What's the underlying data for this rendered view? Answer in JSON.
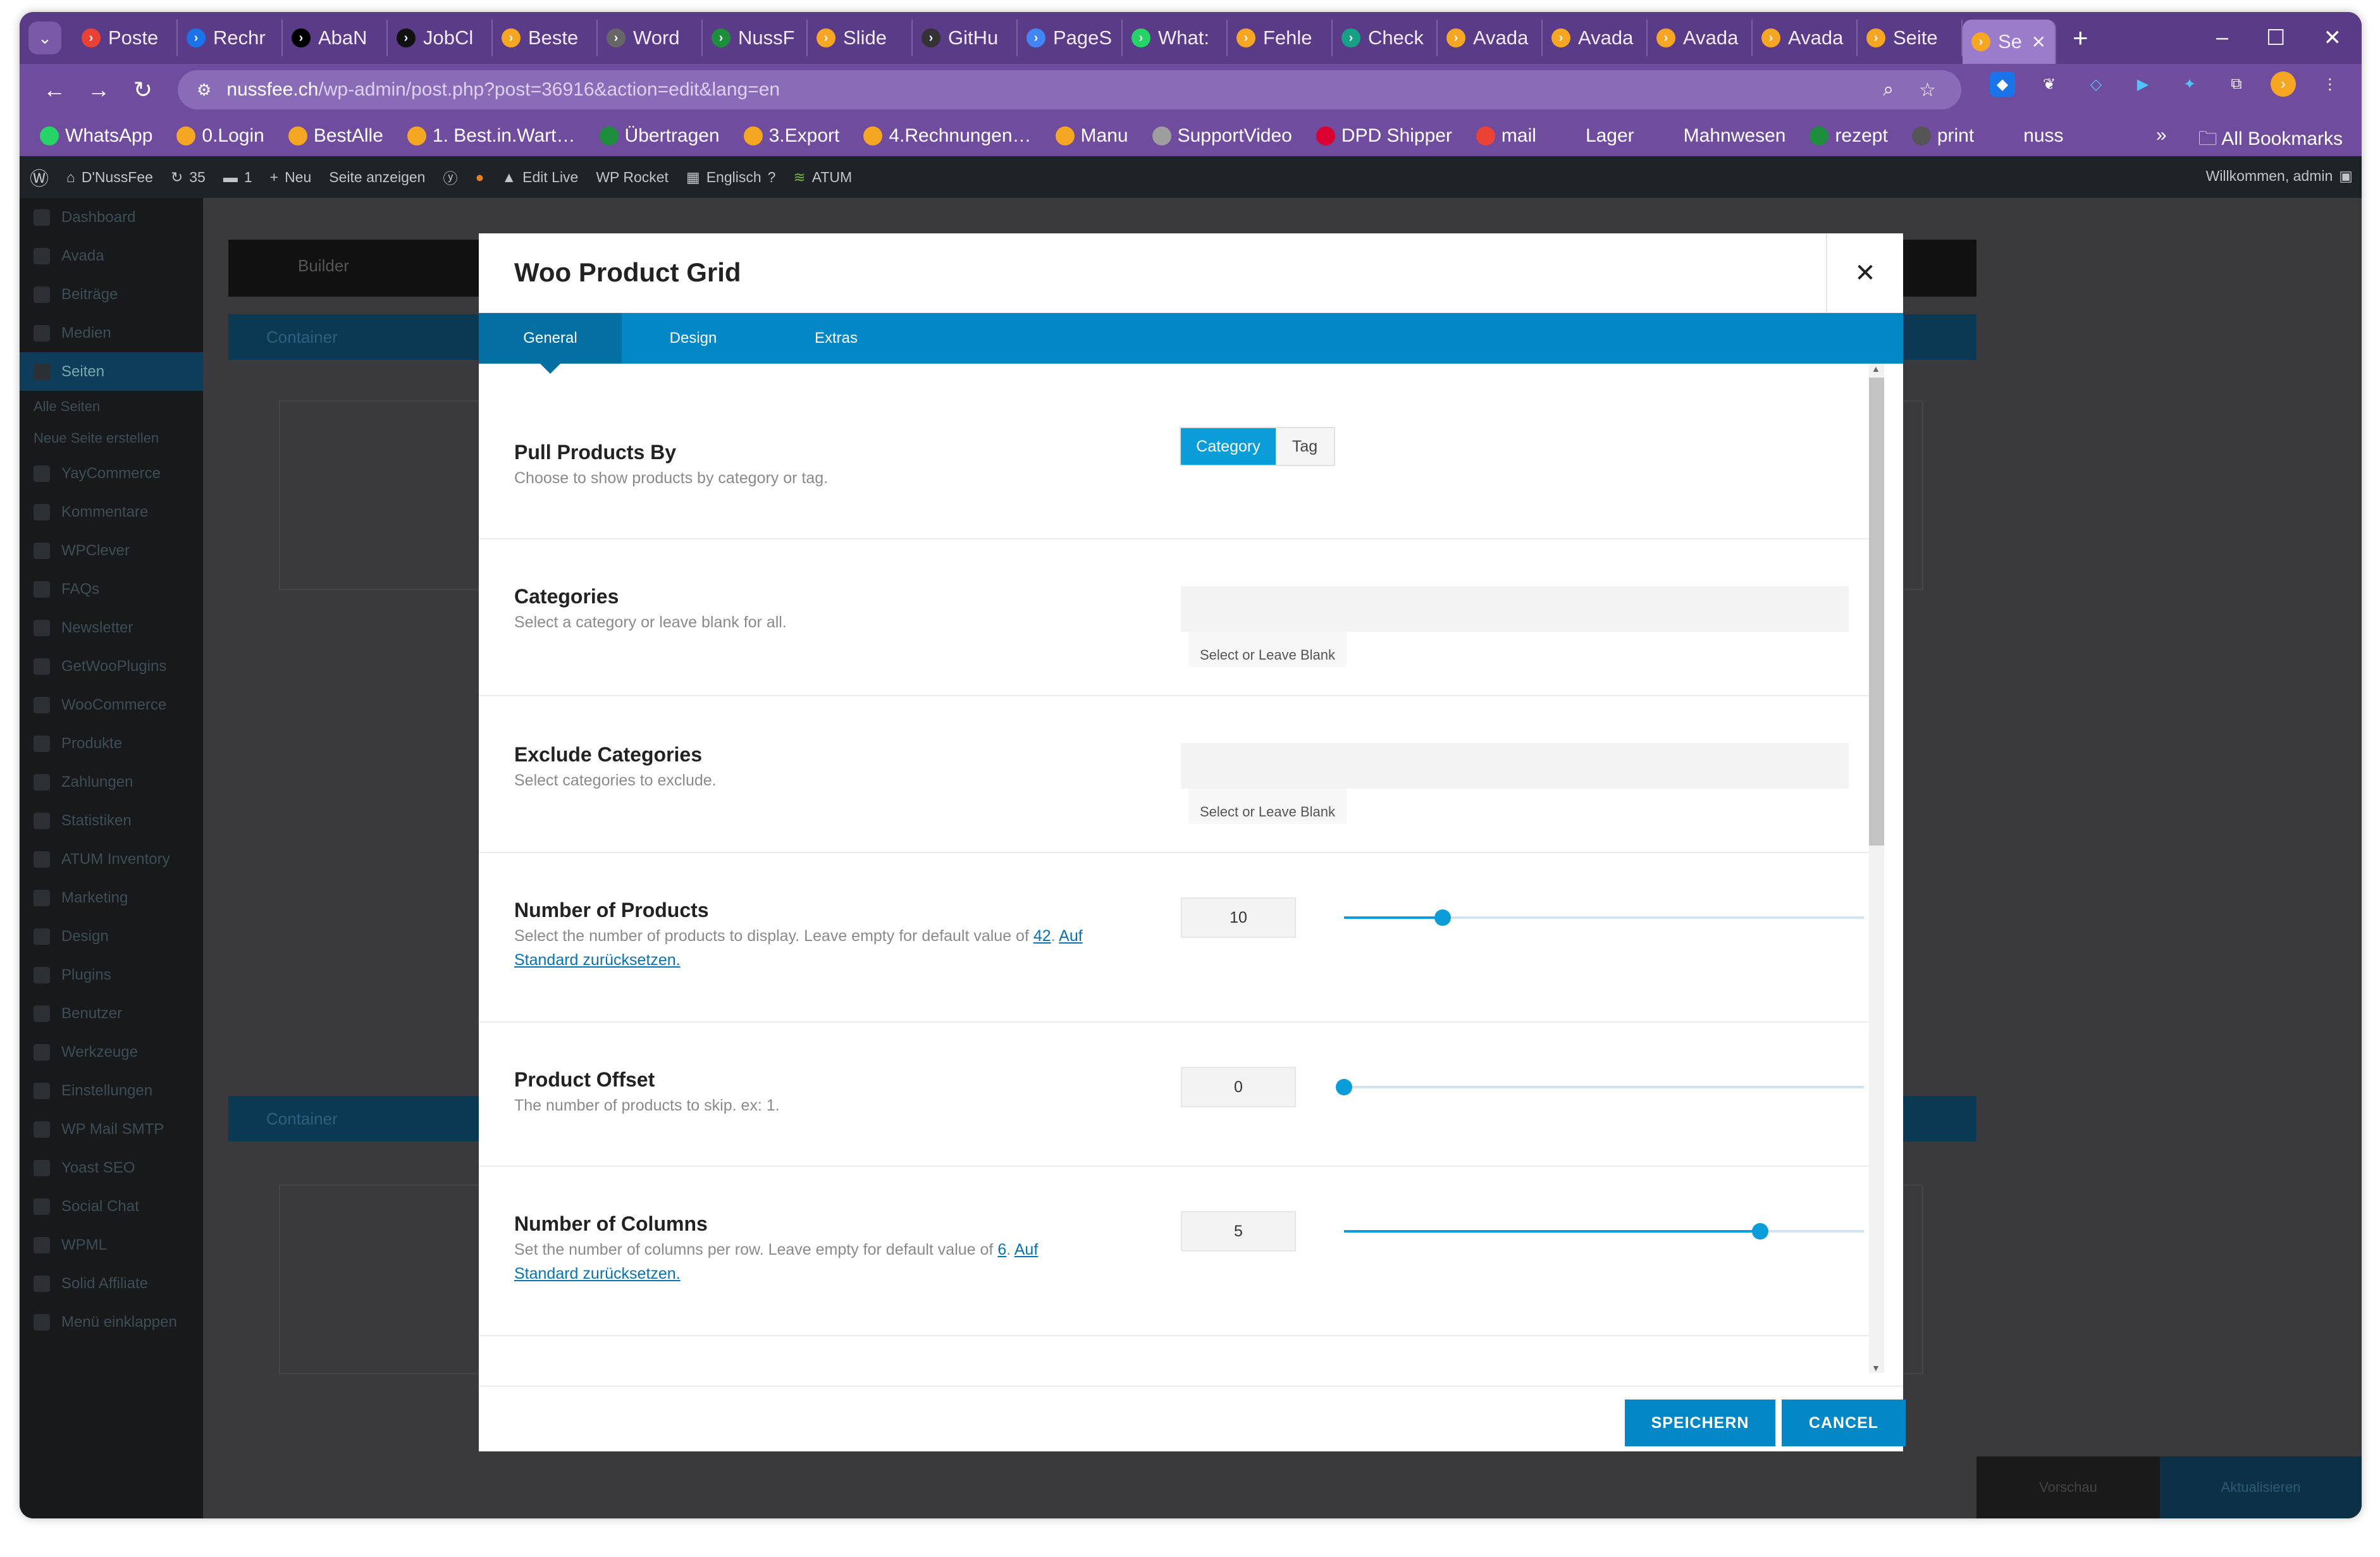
{
  "browser": {
    "tabs": [
      {
        "label": "Poste",
        "icon": "gmail-icon",
        "color": "#ea4335"
      },
      {
        "label": "Rechr",
        "icon": "play-arrow-icon",
        "color": "#1a73e8"
      },
      {
        "label": "AbaN",
        "icon": "notion-icon",
        "color": "#000000"
      },
      {
        "label": "JobCl",
        "icon": "j-icon",
        "color": "#111111"
      },
      {
        "label": "Beste",
        "icon": "avada-icon",
        "color": "#f5a623"
      },
      {
        "label": "Word",
        "icon": "wordpress-icon",
        "color": "#666666"
      },
      {
        "label": "NussF",
        "icon": "plus-sheet-icon",
        "color": "#1e8e3e"
      },
      {
        "label": "Slide",
        "icon": "avada-icon",
        "color": "#f5a623"
      },
      {
        "label": "GitHu",
        "icon": "github-icon",
        "color": "#333333"
      },
      {
        "label": "PageS",
        "icon": "pagespeed-icon",
        "color": "#4285f4"
      },
      {
        "label": "What:",
        "icon": "whatsapp-icon",
        "color": "#25d366"
      },
      {
        "label": "Fehle",
        "icon": "avada-icon",
        "color": "#f5a623"
      },
      {
        "label": "Check",
        "icon": "hexagon-icon",
        "color": "#16a085"
      },
      {
        "label": "Avada",
        "icon": "avada-icon",
        "color": "#f5a623"
      },
      {
        "label": "Avada",
        "icon": "avada-icon",
        "color": "#f5a623"
      },
      {
        "label": "Avada",
        "icon": "avada-icon",
        "color": "#f5a623"
      },
      {
        "label": "Avada",
        "icon": "avada-icon",
        "color": "#f5a623"
      },
      {
        "label": "Seite",
        "icon": "avada-icon",
        "color": "#f5a623"
      }
    ],
    "active_tab": {
      "label": "Se",
      "icon": "avada-icon",
      "color": "#f5a623"
    },
    "new_tab": "+",
    "url_host": "nussfee.ch",
    "url_path": "/wp-admin/post.php?post=36916&action=edit&lang=en",
    "bookmarks": [
      {
        "label": "WhatsApp",
        "color": "#25d366"
      },
      {
        "label": "0.Login",
        "color": "#f5a623"
      },
      {
        "label": "BestAlle",
        "color": "#f5a623"
      },
      {
        "label": "1. Best.in.Wart…",
        "color": "#f5a623"
      },
      {
        "label": "Übertragen",
        "color": "#1e8e3e"
      },
      {
        "label": "3.Export",
        "color": "#f5a623"
      },
      {
        "label": "4.Rechnungen…",
        "color": "#f5a623"
      },
      {
        "label": "Manu",
        "color": "#f5a623"
      },
      {
        "label": "SupportVideo",
        "color": "#9e9e9e"
      },
      {
        "label": "DPD Shipper",
        "color": "#dc0032"
      },
      {
        "label": "mail",
        "color": "#ea4335"
      },
      {
        "label": "Lager",
        "color": "#6f4c9e"
      },
      {
        "label": "Mahnwesen",
        "color": "#6f4c9e"
      },
      {
        "label": "rezept",
        "color": "#1e8e3e"
      },
      {
        "label": "print",
        "color": "#555555"
      },
      {
        "label": "nuss",
        "color": "#6f4c9e"
      }
    ],
    "bookmarks_more": "»",
    "all_bookmarks": "All Bookmarks"
  },
  "adminbar": {
    "site": "D'NussFee",
    "updates": "35",
    "comments": "1",
    "new": "Neu",
    "view": "Seite anzeigen",
    "edit_live": "Edit Live",
    "wp_rocket": "WP Rocket",
    "language": "Englisch",
    "atum": "ATUM",
    "welcome": "Willkommen, admin"
  },
  "wp_menu": [
    "Dashboard",
    "Avada",
    "Beiträge",
    "Medien",
    "Seiten",
    "Alle Seiten",
    "Neue Seite erstellen",
    "YayCommerce",
    "Kommentare",
    "WPClever",
    "FAQs",
    "Newsletter",
    "GetWooPlugins",
    "WooCommerce",
    "Produkte",
    "Zahlungen",
    "Statistiken",
    "ATUM Inventory",
    "Marketing",
    "Design",
    "Plugins",
    "Benutzer",
    "Werkzeuge",
    "Einstellungen",
    "WP Mail SMTP",
    "Yoast SEO",
    "Social Chat",
    "WPML",
    "Solid Affiliate",
    "Menü einklappen"
  ],
  "builder": {
    "tab": "Builder",
    "container": "Container",
    "preview": "Vorschau",
    "update": "Aktualisieren"
  },
  "modal": {
    "title": "Woo Product Grid",
    "tabs": [
      "General",
      "Design",
      "Extras"
    ],
    "pull": {
      "label": "Pull Products By",
      "desc": "Choose to show products by category or tag.",
      "options": [
        "Category",
        "Tag"
      ],
      "selected": "Category"
    },
    "categories": {
      "label": "Categories",
      "desc": "Select a category or leave blank for all.",
      "placeholder": "Select or Leave Blank for All"
    },
    "exclude": {
      "label": "Exclude Categories",
      "desc": "Select categories to exclude.",
      "placeholder": "Select or Leave Blank for None"
    },
    "num_products": {
      "label": "Number of Products",
      "desc_pre": "Select the number of products to display. Leave empty for default value of ",
      "default": "42",
      "reset": "Auf Standard zurücksetzen.",
      "value": "10",
      "fraction": 0.19
    },
    "offset": {
      "label": "Product Offset",
      "desc": "The number of products to skip. ex: 1.",
      "value": "0",
      "fraction": 0.0
    },
    "columns": {
      "label": "Number of Columns",
      "desc_pre": "Set the number of columns per row. Leave empty for default value of ",
      "default": "6",
      "reset": "Auf Standard zurücksetzen.",
      "value": "5",
      "fraction": 0.8
    },
    "save": "SPEICHERN",
    "cancel": "CANCEL"
  }
}
